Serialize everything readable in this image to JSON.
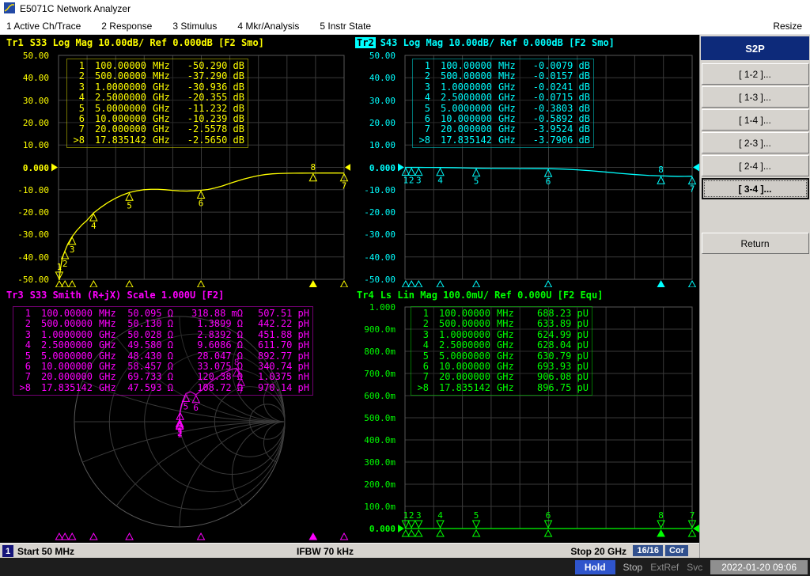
{
  "window": {
    "title": "E5071C Network Analyzer"
  },
  "menu": {
    "items": [
      "1 Active Ch/Trace",
      "2 Response",
      "3 Stimulus",
      "4 Mkr/Analysis",
      "5 Instr State"
    ],
    "resize_label": "Resize"
  },
  "softkeys": {
    "title": "S2P",
    "buttons": [
      "[ 1-2 ]...",
      "[ 1-3 ]...",
      "[ 1-4 ]...",
      "[ 2-3 ]...",
      "[ 2-4 ]...",
      "[ 3-4 ]...",
      "Return"
    ],
    "active_index": 5
  },
  "status_bar": {
    "channel": "1",
    "start": "Start 50 MHz",
    "ifbw": "IFBW 70 kHz",
    "stop": "Stop 20 GHz",
    "avg": "16/16",
    "cor": "Cor"
  },
  "instrument_bar": {
    "hold": "Hold",
    "stop": "Stop",
    "extref": "ExtRef",
    "svc": "Svc",
    "datetime": "2022-01-20 09:06"
  },
  "chart_data": [
    {
      "id": "tr1",
      "type": "line",
      "trace_label": "Tr1",
      "title": "S33 Log Mag 10.00dB/ Ref 0.000dB [F2 Smo]",
      "color": "#ffff00",
      "active_trace": false,
      "active_marker": "8",
      "x_range_ghz": [
        0.05,
        20
      ],
      "ylim": [
        -50,
        50
      ],
      "ref_value": 0,
      "ref_tick_index": 5,
      "yticks": [
        "50.00",
        "40.00",
        "30.00",
        "20.00",
        "10.00",
        "0.000",
        "-10.00",
        "-20.00",
        "-30.00",
        "-40.00",
        "-50.00"
      ],
      "x": [
        0.05,
        0.08,
        0.1,
        0.15,
        0.2,
        0.3,
        0.4,
        0.5,
        0.7,
        1.0,
        1.3,
        1.7,
        2.0,
        2.5,
        3.0,
        3.5,
        4.0,
        4.5,
        5.0,
        5.5,
        6.0,
        6.5,
        7.0,
        7.5,
        8.0,
        8.5,
        9.0,
        9.5,
        10.0,
        10.5,
        11.0,
        11.5,
        12.0,
        12.5,
        13.0,
        13.5,
        14.0,
        14.5,
        15.0,
        15.5,
        16.0,
        16.5,
        17.0,
        17.835,
        18.5,
        19.0,
        19.5,
        20.0
      ],
      "y": [
        -54,
        -51.5,
        -50.29,
        -47.2,
        -44.6,
        -41.0,
        -38.9,
        -37.29,
        -34.2,
        -30.94,
        -28.4,
        -25.6,
        -23.9,
        -20.36,
        -17.9,
        -15.7,
        -13.9,
        -12.4,
        -11.23,
        -10.5,
        -10.0,
        -9.8,
        -9.8,
        -10.0,
        -10.3,
        -10.5,
        -10.6,
        -10.45,
        -10.24,
        -9.9,
        -9.2,
        -8.3,
        -7.2,
        -6.2,
        -5.2,
        -4.4,
        -3.7,
        -3.2,
        -2.9,
        -2.75,
        -2.65,
        -2.6,
        -2.58,
        -2.565,
        -2.545,
        -2.535,
        -2.545,
        -2.558
      ],
      "markers": [
        {
          "n": "1",
          "f": 0.1,
          "v": -50.29
        },
        {
          "n": "2",
          "f": 0.5,
          "v": -37.29
        },
        {
          "n": "3",
          "f": 1.0,
          "v": -30.936
        },
        {
          "n": "4",
          "f": 2.5,
          "v": -20.355
        },
        {
          "n": "5",
          "f": 5.0,
          "v": -11.232
        },
        {
          "n": "6",
          "f": 10.0,
          "v": -10.239
        },
        {
          "n": "7",
          "f": 20.0,
          "v": -2.5578
        },
        {
          "n": "8",
          "f": 17.835142,
          "v": -2.565
        }
      ],
      "readout": [
        {
          "n": "1",
          "freq": "100.00000",
          "unit": "MHz",
          "vals": [
            "-50.290 dB"
          ]
        },
        {
          "n": "2",
          "freq": "500.00000",
          "unit": "MHz",
          "vals": [
            "-37.290 dB"
          ]
        },
        {
          "n": "3",
          "freq": "1.0000000",
          "unit": "GHz",
          "vals": [
            "-30.936 dB"
          ]
        },
        {
          "n": "4",
          "freq": "2.5000000",
          "unit": "GHz",
          "vals": [
            "-20.355 dB"
          ]
        },
        {
          "n": "5",
          "freq": "5.0000000",
          "unit": "GHz",
          "vals": [
            "-11.232 dB"
          ]
        },
        {
          "n": "6",
          "freq": "10.000000",
          "unit": "GHz",
          "vals": [
            "-10.239 dB"
          ]
        },
        {
          "n": "7",
          "freq": "20.000000",
          "unit": "GHz",
          "vals": [
            "-2.5578 dB"
          ]
        },
        {
          "n": ">8",
          "freq": "17.835142",
          "unit": "GHz",
          "vals": [
            "-2.5650 dB"
          ]
        }
      ]
    },
    {
      "id": "tr2",
      "type": "line",
      "trace_label": "Tr2",
      "title": "S43 Log Mag 10.00dB/ Ref 0.000dB [F2 Smo]",
      "color": "#00ffff",
      "active_trace": true,
      "active_marker": "8",
      "x_range_ghz": [
        0.05,
        20
      ],
      "ylim": [
        -50,
        50
      ],
      "ref_value": 0,
      "ref_tick_index": 5,
      "yticks": [
        "50.00",
        "40.00",
        "30.00",
        "20.00",
        "10.00",
        "0.000",
        "-10.00",
        "-20.00",
        "-30.00",
        "-40.00",
        "-50.00"
      ],
      "x": [
        0.05,
        0.5,
        1.0,
        1.5,
        2.0,
        2.5,
        3.0,
        3.5,
        4.0,
        4.5,
        5.0,
        6.0,
        7.0,
        8.0,
        9.0,
        10.0,
        11.0,
        12.0,
        13.0,
        14.0,
        15.0,
        16.0,
        17.0,
        17.835,
        18.5,
        19.0,
        19.5,
        20.0
      ],
      "y": [
        -0.008,
        -0.016,
        -0.024,
        -0.04,
        -0.055,
        -0.072,
        -0.11,
        -0.16,
        -0.22,
        -0.3,
        -0.38,
        -0.44,
        -0.49,
        -0.53,
        -0.56,
        -0.589,
        -0.78,
        -1.1,
        -1.55,
        -2.1,
        -2.7,
        -3.2,
        -3.62,
        -3.791,
        -3.95,
        -4.05,
        -4.03,
        -3.952
      ],
      "markers": [
        {
          "n": "1",
          "f": 0.1,
          "v": -0.0079
        },
        {
          "n": "2",
          "f": 0.5,
          "v": -0.0157
        },
        {
          "n": "3",
          "f": 1.0,
          "v": -0.0241
        },
        {
          "n": "4",
          "f": 2.5,
          "v": -0.0715
        },
        {
          "n": "5",
          "f": 5.0,
          "v": -0.3803
        },
        {
          "n": "6",
          "f": 10.0,
          "v": -0.5892
        },
        {
          "n": "7",
          "f": 20.0,
          "v": -3.9524
        },
        {
          "n": "8",
          "f": 17.835142,
          "v": -3.7906
        }
      ],
      "readout": [
        {
          "n": "1",
          "freq": "100.00000",
          "unit": "MHz",
          "vals": [
            "-0.0079 dB"
          ]
        },
        {
          "n": "2",
          "freq": "500.00000",
          "unit": "MHz",
          "vals": [
            "-0.0157 dB"
          ]
        },
        {
          "n": "3",
          "freq": "1.0000000",
          "unit": "GHz",
          "vals": [
            "-0.0241 dB"
          ]
        },
        {
          "n": "4",
          "freq": "2.5000000",
          "unit": "GHz",
          "vals": [
            "-0.0715 dB"
          ]
        },
        {
          "n": "5",
          "freq": "5.0000000",
          "unit": "GHz",
          "vals": [
            "-0.3803 dB"
          ]
        },
        {
          "n": "6",
          "freq": "10.000000",
          "unit": "GHz",
          "vals": [
            "-0.5892 dB"
          ]
        },
        {
          "n": "7",
          "freq": "20.000000",
          "unit": "GHz",
          "vals": [
            "-3.9524 dB"
          ]
        },
        {
          "n": ">8",
          "freq": "17.835142",
          "unit": "GHz",
          "vals": [
            "-3.7906 dB"
          ]
        }
      ]
    },
    {
      "id": "tr3",
      "type": "smith",
      "trace_label": "Tr3",
      "title": "S33 Smith (R+jX) Scale 1.000U [F2]",
      "color": "#ff00ff",
      "active_trace": false,
      "active_marker": "8",
      "x_range_ghz": [
        0.05,
        20
      ],
      "g_points": [
        [
          0.001,
          0.003
        ],
        [
          0.002,
          0.014
        ],
        [
          0.001,
          0.028
        ],
        [
          0.002,
          0.055
        ],
        [
          0.005,
          0.096
        ],
        [
          0.02,
          0.165
        ],
        [
          0.06,
          0.268
        ],
        [
          0.105,
          0.285
        ],
        [
          0.156,
          0.257
        ],
        [
          0.21,
          0.3
        ],
        [
          0.299,
          0.382
        ],
        [
          0.425,
          0.466
        ],
        [
          0.5,
          0.5
        ],
        [
          0.543,
          0.509
        ],
        [
          0.567,
          0.474
        ],
        [
          0.585,
          0.418
        ]
      ],
      "markers": [
        {
          "n": "1",
          "f": 0.1,
          "g": [
            0.001,
            0.003
          ]
        },
        {
          "n": "2",
          "f": 0.5,
          "g": [
            0.002,
            0.014
          ]
        },
        {
          "n": "3",
          "f": 1.0,
          "g": [
            0.001,
            0.028
          ]
        },
        {
          "n": "4",
          "f": 2.5,
          "g": [
            0.005,
            0.096
          ]
        },
        {
          "n": "5",
          "f": 5.0,
          "g": [
            0.06,
            0.268
          ]
        },
        {
          "n": "6",
          "f": 10.0,
          "g": [
            0.156,
            0.257
          ]
        },
        {
          "n": "7",
          "f": 20.0,
          "g": [
            0.585,
            0.418
          ]
        },
        {
          "n": "8",
          "f": 17.835142,
          "g": [
            0.543,
            0.509
          ]
        }
      ],
      "readout": [
        {
          "n": "1",
          "freq": "100.00000",
          "unit": "MHz",
          "vals": [
            "50.095 Ω",
            "318.88 mΩ",
            "507.51 pH"
          ]
        },
        {
          "n": "2",
          "freq": "500.00000",
          "unit": "MHz",
          "vals": [
            "50.130 Ω",
            "1.3899 Ω",
            "442.22 pH"
          ]
        },
        {
          "n": "3",
          "freq": "1.0000000",
          "unit": "GHz",
          "vals": [
            "50.028 Ω",
            "2.8392 Ω",
            "451.88 pH"
          ]
        },
        {
          "n": "4",
          "freq": "2.5000000",
          "unit": "GHz",
          "vals": [
            "49.580 Ω",
            "9.6086 Ω",
            "611.70 pH"
          ]
        },
        {
          "n": "5",
          "freq": "5.0000000",
          "unit": "GHz",
          "vals": [
            "48.430 Ω",
            "28.047 Ω",
            "892.77 pH"
          ]
        },
        {
          "n": "6",
          "freq": "10.000000",
          "unit": "GHz",
          "vals": [
            "58.457 Ω",
            "33.075 Ω",
            "340.74 pH"
          ]
        },
        {
          "n": "7",
          "freq": "20.000000",
          "unit": "GHz",
          "vals": [
            "69.733 Ω",
            "120.38 Ω",
            "1.0375 nH"
          ]
        },
        {
          "n": ">8",
          "freq": "17.835142",
          "unit": "GHz",
          "vals": [
            "47.593 Ω",
            "108.72 Ω",
            "970.14 pH"
          ]
        }
      ]
    },
    {
      "id": "tr4",
      "type": "line",
      "trace_label": "Tr4",
      "title": "Ls Lin Mag 100.0mU/ Ref 0.000U [F2 Equ]",
      "color": "#00ff00",
      "active_trace": false,
      "active_marker": "8",
      "x_range_ghz": [
        0.05,
        20
      ],
      "ylim": [
        0,
        1
      ],
      "ref_value": 0,
      "ref_tick_index": 10,
      "yticks": [
        "1.000",
        "900.0m",
        "800.0m",
        "700.0m",
        "600.0m",
        "500.0m",
        "400.0m",
        "300.0m",
        "200.0m",
        "100.0m",
        "0.000"
      ],
      "x": [
        0.05,
        20
      ],
      "y": [
        0,
        0
      ],
      "markers": [
        {
          "n": "1",
          "f": 0.1,
          "v": 0
        },
        {
          "n": "2",
          "f": 0.5,
          "v": 0
        },
        {
          "n": "3",
          "f": 1.0,
          "v": 0
        },
        {
          "n": "4",
          "f": 2.5,
          "v": 0
        },
        {
          "n": "5",
          "f": 5.0,
          "v": 0
        },
        {
          "n": "6",
          "f": 10.0,
          "v": 0
        },
        {
          "n": "7",
          "f": 20.0,
          "v": 0
        },
        {
          "n": "8",
          "f": 17.835142,
          "v": 0
        }
      ],
      "readout": [
        {
          "n": "1",
          "freq": "100.00000",
          "unit": "MHz",
          "vals": [
            "688.23 pU"
          ]
        },
        {
          "n": "2",
          "freq": "500.00000",
          "unit": "MHz",
          "vals": [
            "633.89 pU"
          ]
        },
        {
          "n": "3",
          "freq": "1.0000000",
          "unit": "GHz",
          "vals": [
            "624.99 pU"
          ]
        },
        {
          "n": "4",
          "freq": "2.5000000",
          "unit": "GHz",
          "vals": [
            "628.04 pU"
          ]
        },
        {
          "n": "5",
          "freq": "5.0000000",
          "unit": "GHz",
          "vals": [
            "630.79 pU"
          ]
        },
        {
          "n": "6",
          "freq": "10.000000",
          "unit": "GHz",
          "vals": [
            "693.93 pU"
          ]
        },
        {
          "n": "7",
          "freq": "20.000000",
          "unit": "GHz",
          "vals": [
            "906.08 pU"
          ]
        },
        {
          "n": ">8",
          "freq": "17.835142",
          "unit": "GHz",
          "vals": [
            "896.75 pU"
          ]
        }
      ]
    }
  ]
}
